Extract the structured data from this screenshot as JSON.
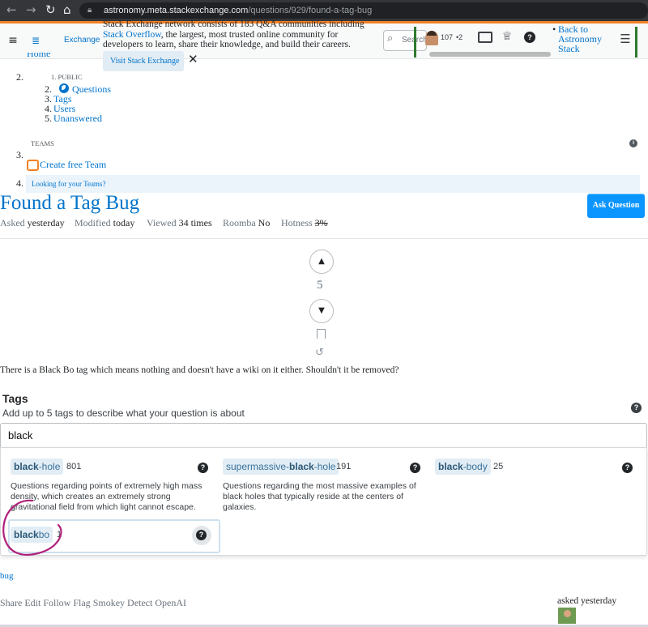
{
  "browser": {
    "url_host": "astronomy.meta.stackexchange.com",
    "url_path": "/questions/929/found-a-tag-bug"
  },
  "topbar": {
    "exchange_label": "Exchange",
    "popover_line1": "Stack Exchange network consists of 183 Q&A communities including",
    "popover_link": "Stack Overflow",
    "popover_line2_rest": ", the largest, most trusted online community for",
    "popover_line3": "developers to learn, share their knowledge, and build their careers.",
    "visit_button": "Visit Stack Exchange",
    "search_placeholder": "Search",
    "reputation": "107",
    "badges": "•2",
    "back_line1": "Back to",
    "back_line2": "Astronomy",
    "back_line3": "Stack"
  },
  "leftnav": {
    "home": "Home",
    "num2": "2.",
    "public_num": "1.",
    "public_label": "PUBLIC",
    "items": [
      {
        "num": "2.",
        "label": "Questions"
      },
      {
        "num": "3.",
        "label": "Tags"
      },
      {
        "num": "4.",
        "label": "Users"
      },
      {
        "num": "5.",
        "label": "Unanswered"
      }
    ],
    "teams_label": "TEAMS",
    "num3": "3.",
    "create_team": "Create free Team",
    "num4": "4.",
    "looking": "Looking for your Teams?"
  },
  "question": {
    "title": "Found a Tag Bug",
    "ask_button": "Ask Question",
    "asked_key": "Asked",
    "asked_val": "yesterday",
    "modified_key": "Modified",
    "modified_val": "today",
    "viewed_key": "Viewed",
    "viewed_val": "34 times",
    "roomba_key": "Roomba",
    "roomba_val": "No",
    "hotness_key": "Hotness",
    "hotness_val": "3%",
    "score": "5",
    "body": "There is a Black Bo tag which means nothing and doesn't have a wiki on it either. Shouldn't it be removed?"
  },
  "tags_editor": {
    "label": "Tags",
    "hint": "Add up to 5 tags to describe what your question is about",
    "input_value": "black",
    "suggestions": [
      {
        "bold": "black",
        "rest": "-hole",
        "count": "801",
        "desc": [
          "Questions regarding points of extremely high mass",
          "density, which creates an extremely strong",
          "gravitational field from which light cannot escape."
        ]
      },
      {
        "pre": "supermassive-",
        "bold": "black",
        "rest": "-hole",
        "count": "191",
        "desc": [
          "Questions regarding the most massive examples of",
          "black holes that typically reside at the centers of",
          "galaxies."
        ]
      },
      {
        "bold": "black",
        "rest": "-body",
        "count": "25",
        "desc": []
      },
      {
        "bold": "black",
        "rest": "bo",
        "count": "1",
        "desc": []
      }
    ]
  },
  "post": {
    "tag": "bug",
    "menu": [
      "Share",
      "Edit",
      "Follow",
      "Flag",
      "Smokey",
      "Detect OpenAI"
    ],
    "asked_label": "asked yesterday"
  },
  "colors": {
    "accent": "#f48225",
    "link": "#0074cc",
    "ask_button": "#0a95ff",
    "annotation": "#b0207a",
    "tag_bg": "#e1ecf4"
  }
}
